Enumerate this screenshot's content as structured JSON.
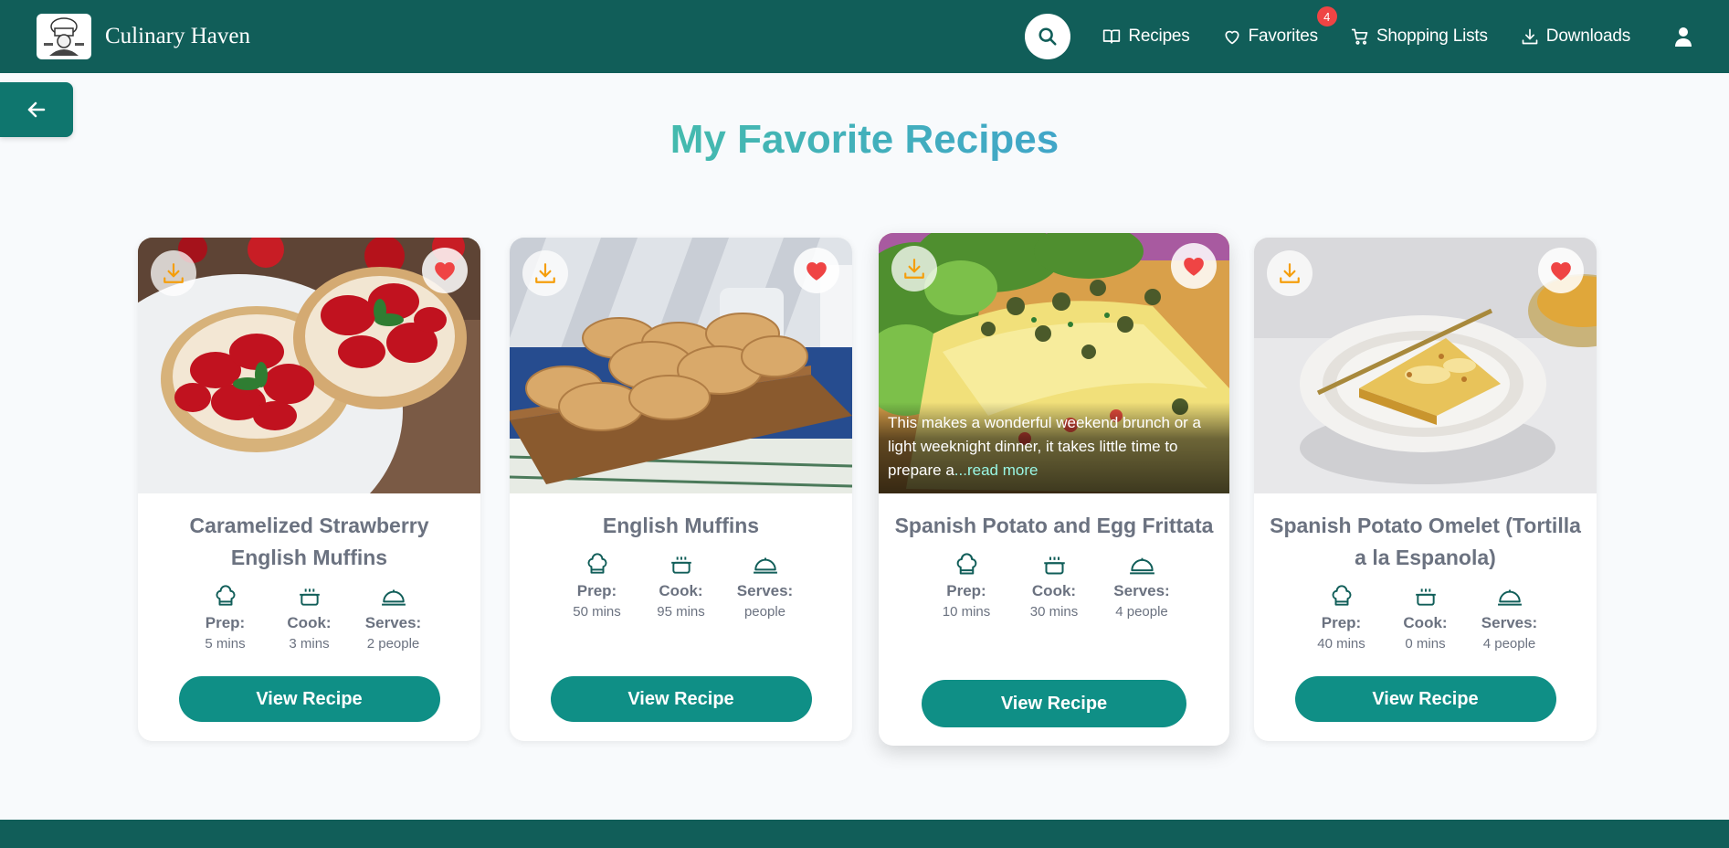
{
  "brand": {
    "name": "Culinary Haven"
  },
  "nav": {
    "recipes": "Recipes",
    "favorites": "Favorites",
    "favorites_count": "4",
    "shopping_lists": "Shopping Lists",
    "downloads": "Downloads"
  },
  "page": {
    "title": "My Favorite Recipes"
  },
  "labels": {
    "prep": "Prep:",
    "cook": "Cook:",
    "serves": "Serves:",
    "view": "View Recipe"
  },
  "recipes": [
    {
      "title": "Caramelized Strawberry English Muffins",
      "prep": "5 mins",
      "cook": "3 mins",
      "serves": "2 people"
    },
    {
      "title": "English Muffins",
      "prep": "50 mins",
      "cook": "95 mins",
      "serves": "people"
    },
    {
      "title": "Spanish Potato and Egg Frittata",
      "prep": "10 mins",
      "cook": "30 mins",
      "serves": "4 people",
      "description": "This makes a wonderful weekend brunch or a light weeknight dinner, it takes little time to prepare a",
      "read_more": "...read more"
    },
    {
      "title": "Spanish Potato Omelet (Tortilla a la Espanola)",
      "prep": "40 mins",
      "cook": "0 mins",
      "serves": "4 people"
    }
  ],
  "colors": {
    "primary": "#115e59",
    "button": "#0f8f86",
    "heart": "#ef4444",
    "download": "#f59e0b"
  }
}
